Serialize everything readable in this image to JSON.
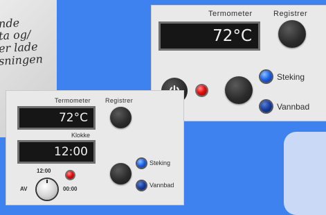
{
  "background_note_lines": [
    "nde",
    "ta og/",
    "er lade",
    "sningen"
  ],
  "big_panel": {
    "thermometer_label": "Termometer",
    "thermometer_value": "72°C",
    "register_label": "Registrer",
    "mode_options": [
      {
        "label": "Steking",
        "selected": true
      },
      {
        "label": "Vannbad",
        "selected": false
      }
    ]
  },
  "small_panel": {
    "thermometer_label": "Termometer",
    "thermometer_value": "72°C",
    "register_label": "Registrer",
    "clock_label": "Klokke",
    "clock_value": "12:00",
    "timer_top": "12:00",
    "timer_off": "AV",
    "timer_right": "00:00",
    "mode_options": [
      {
        "label": "Steking",
        "selected": true
      },
      {
        "label": "Vannbad",
        "selected": false
      }
    ]
  },
  "colors": {
    "background": "#3d82ee",
    "panel": "#e9e9e9",
    "display": "#161616",
    "led_red": "#e01010",
    "led_blue": "#1a5ee0"
  }
}
